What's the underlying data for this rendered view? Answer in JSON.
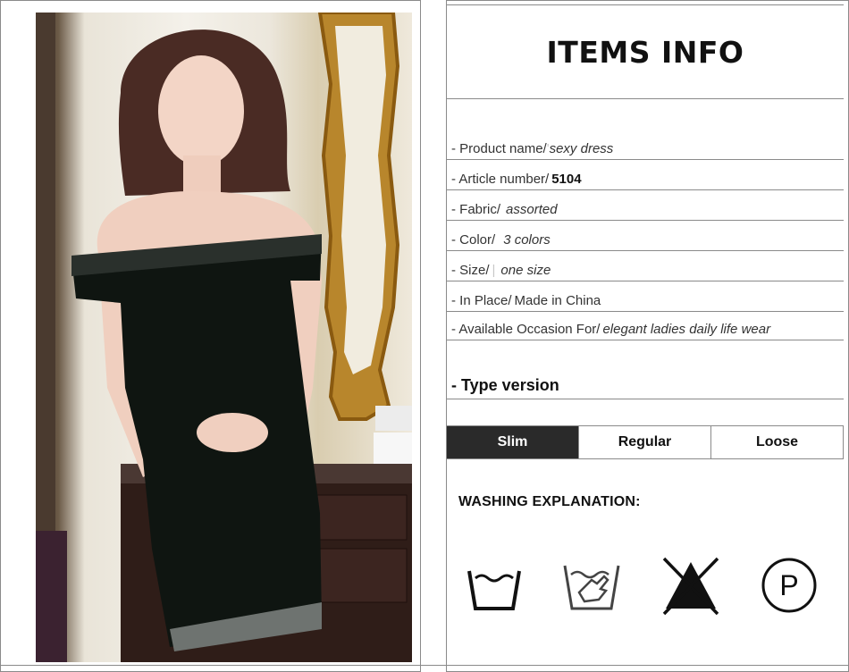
{
  "title": "ITEMS INFO",
  "product_rows": [
    {
      "label": "- Product name/",
      "tick": "'",
      "value": "sexy dress",
      "style": "italic"
    },
    {
      "label": "- Article number/",
      "tick": "",
      "value": "5104",
      "style": "bold"
    },
    {
      "label": "- Fabric/",
      "tick": "",
      "value": "assorted",
      "style": "italic"
    },
    {
      "label": "- Color/",
      "tick": "",
      "value": "3 colors",
      "style": "italic"
    },
    {
      "label": "- Size/",
      "tick": "|",
      "value": "one size",
      "style": "italic"
    },
    {
      "label": "- In Place/",
      "tick": "",
      "value": "Made in China",
      "style": "plain"
    },
    {
      "label": "- Available Occasion For/",
      "tick": "",
      "value": "elegant ladies daily life wear",
      "style": "italic"
    }
  ],
  "type_version_label": "- Type version",
  "fit_options": [
    {
      "label": "Slim",
      "selected": true
    },
    {
      "label": "Regular",
      "selected": false
    },
    {
      "label": "Loose",
      "selected": false
    }
  ],
  "washing_title": "WASHING EXPLANATION:",
  "washing_icons": [
    {
      "name": "wash-tub-icon"
    },
    {
      "name": "hand-wash-icon"
    },
    {
      "name": "no-bleach-icon"
    },
    {
      "name": "dry-clean-p-icon",
      "letter": "P"
    }
  ],
  "colors": {
    "fit_selected_bg": "#2a2a2a",
    "border": "#8a8a8a"
  }
}
